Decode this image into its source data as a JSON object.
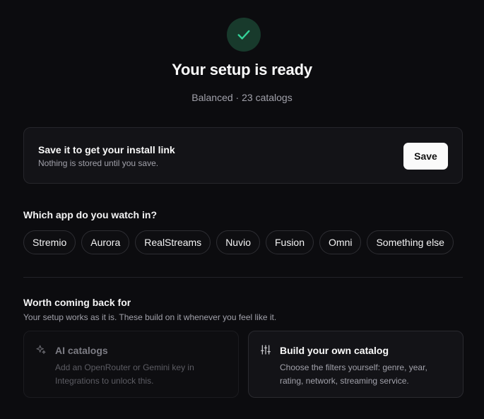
{
  "header": {
    "title": "Your setup is ready",
    "subtitle": "Balanced · 23 catalogs",
    "status_icon": "check-icon",
    "accent_color": "#34d399"
  },
  "save_card": {
    "title": "Save it to get your install link",
    "subtitle": "Nothing is stored until you save.",
    "button_label": "Save"
  },
  "apps": {
    "label": "Which app do you watch in?",
    "options": [
      "Stremio",
      "Aurora",
      "RealStreams",
      "Nuvio",
      "Fusion",
      "Omni",
      "Something else"
    ]
  },
  "extras": {
    "title": "Worth coming back for",
    "subtitle": "Your setup works as it is. These build on it whenever you feel like it.",
    "cards": [
      {
        "icon": "sparkles-icon",
        "title": "AI catalogs",
        "description": "Add an OpenRouter or Gemini key in Integrations to unlock this.",
        "disabled": true
      },
      {
        "icon": "sliders-icon",
        "title": "Build your own catalog",
        "description": "Choose the filters yourself: genre, year, rating, network, streaming service.",
        "disabled": false
      }
    ]
  }
}
